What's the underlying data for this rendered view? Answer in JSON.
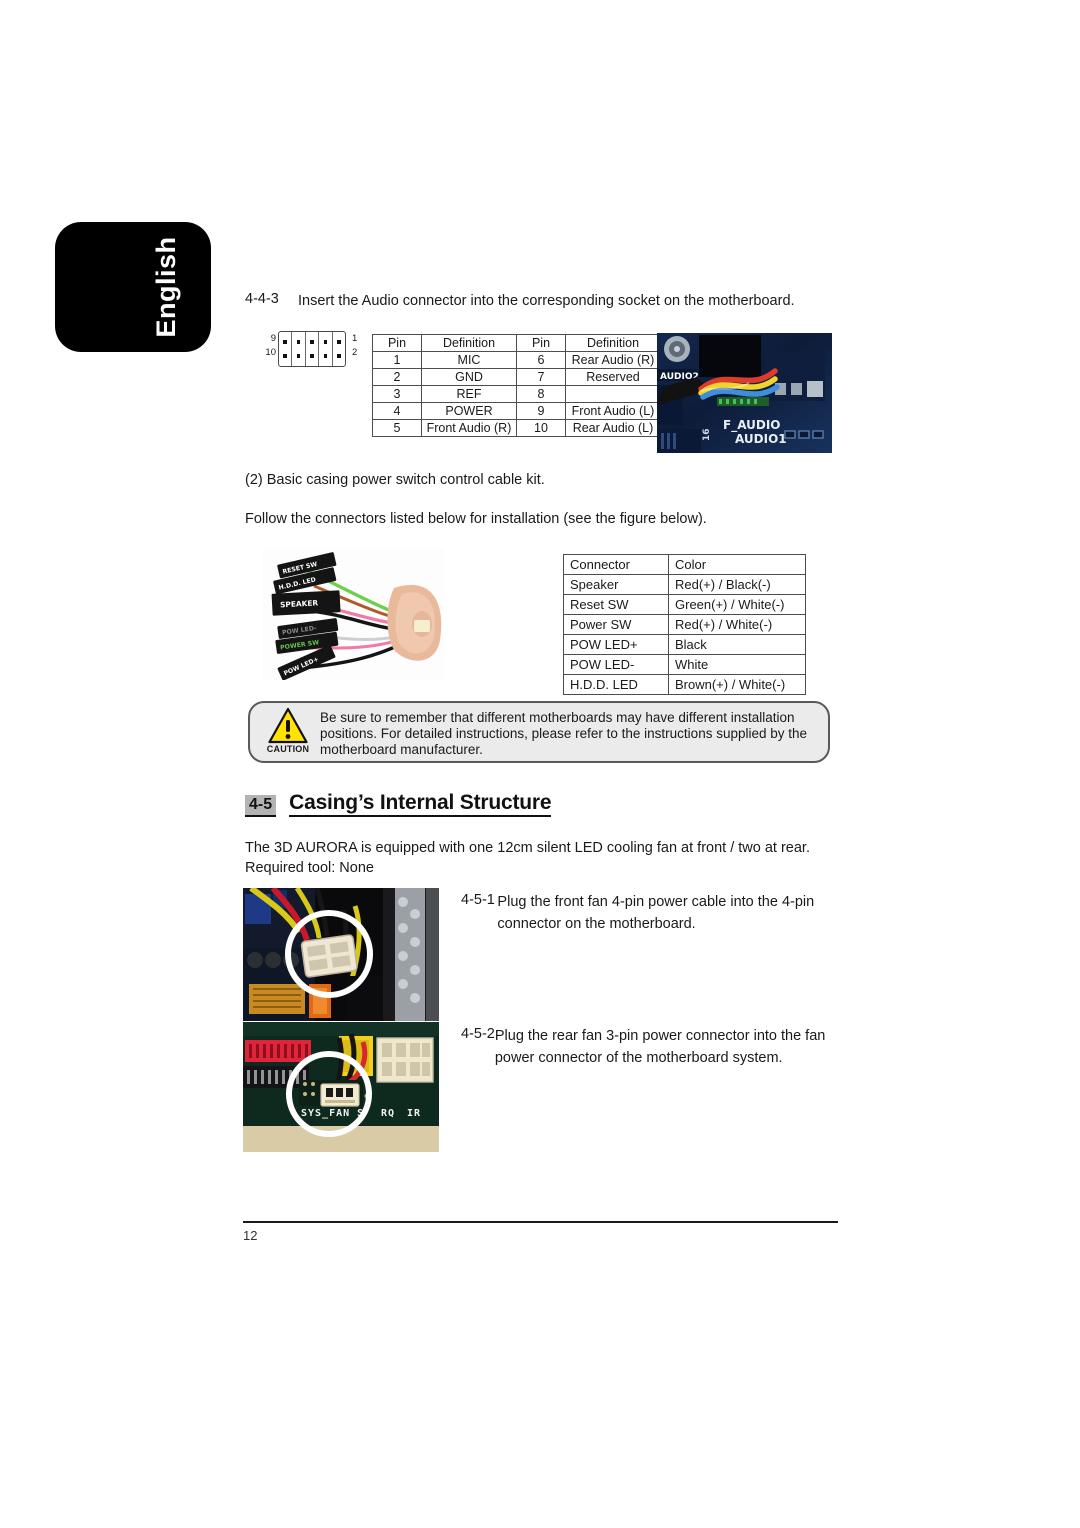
{
  "language_tab": {
    "label": "English"
  },
  "section_443": {
    "number": "4-4-3",
    "text": "Insert the Audio connector into the corresponding socket on the motherboard."
  },
  "pin_header_diagram": {
    "left_top_label": "9",
    "left_bottom_label": "10",
    "right_top_label": "1",
    "right_bottom_label": "2",
    "pin_count": 10
  },
  "audio_table": {
    "headers": [
      "Pin",
      "Definition",
      "Pin",
      "Definition"
    ],
    "rows": [
      [
        "1",
        "MIC",
        "6",
        "Rear Audio (R)"
      ],
      [
        "2",
        "GND",
        "7",
        "Reserved"
      ],
      [
        "3",
        "REF",
        "8",
        ""
      ],
      [
        "4",
        "POWER",
        "9",
        "Front Audio (L)"
      ],
      [
        "5",
        "Front Audio (R)",
        "10",
        "Rear Audio (L)"
      ]
    ]
  },
  "photo_faudio": {
    "label_audio2": "AUDIO2",
    "label_f_audio": "F_AUDIO",
    "label_audio1": "AUDIO1"
  },
  "paragraph_2": "(2) Basic casing power switch control cable kit.",
  "paragraph_follow": "Follow the connectors listed below for installation (see the figure below).",
  "photo_cables": {
    "tags": [
      "RESET SW",
      "H.D.D. LED",
      "SPEAKER",
      "POW LED-",
      "POWER SW",
      "POW LED+"
    ]
  },
  "connector_table": {
    "headers": [
      "Connector",
      "Color"
    ],
    "rows": [
      [
        "Speaker",
        "Red(+) / Black(-)"
      ],
      [
        "Reset SW",
        "Green(+) / White(-)"
      ],
      [
        "Power SW",
        "Red(+) / White(-)"
      ],
      [
        "POW LED+",
        "Black"
      ],
      [
        "POW LED-",
        "White"
      ],
      [
        "H.D.D. LED",
        "Brown(+) / White(-)"
      ]
    ]
  },
  "caution": {
    "label": "CAUTION",
    "text": "Be sure to remember that different motherboards may have different installation positions. For detailed instructions, please refer to the instructions supplied by the motherboard manufacturer."
  },
  "section_45": {
    "number": "4-5",
    "title": "Casing’s Internal Structure",
    "intro_line1": "The 3D AURORA is equipped with one 12cm silent LED cooling fan at front / two at rear.",
    "intro_line2": "Required tool: None"
  },
  "section_451": {
    "number": "4-5-1",
    "text": "Plug the front fan 4-pin power cable into the 4-pin connector on the motherboard."
  },
  "section_452": {
    "number": "4-5-2",
    "text": "Plug the rear fan 3-pin power connector into the fan power connector of the motherboard system."
  },
  "photo_fan3": {
    "silkscreen": "SYS_FAN  S  IRQ    IR"
  },
  "footer": {
    "page_number": "12"
  },
  "colors": {
    "caution_yellow": "#FFE400",
    "caution_box_bg": "#EBEBEB",
    "section_badge_gray": "#B3B3B3",
    "tab_black": "#000000"
  }
}
